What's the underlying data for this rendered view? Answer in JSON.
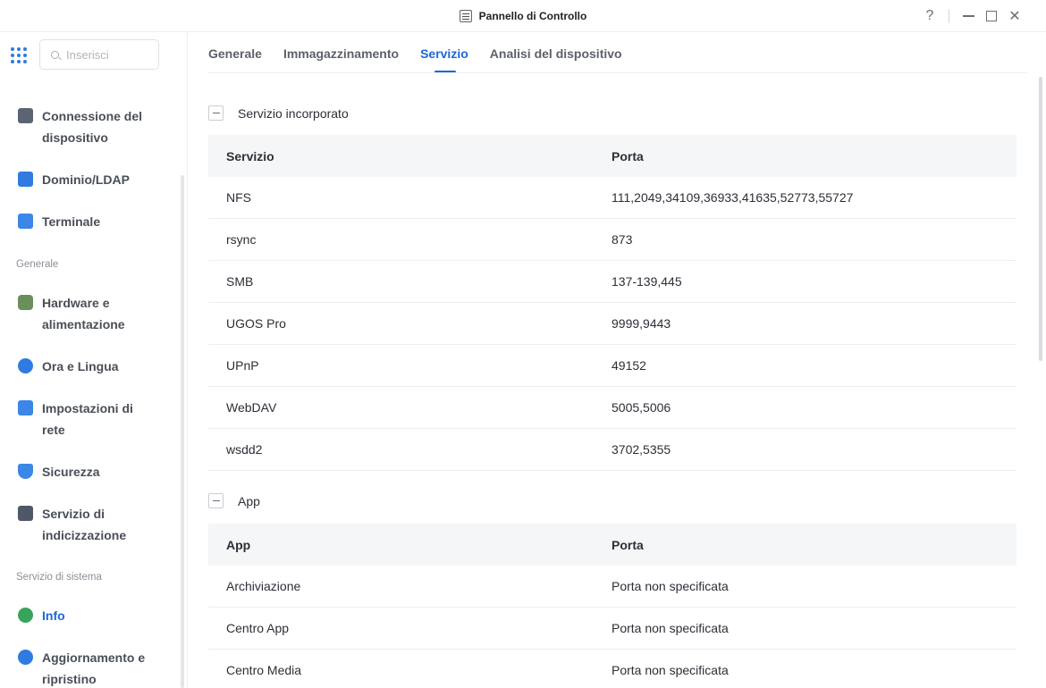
{
  "window": {
    "title": "Pannello di Controllo",
    "help": "?",
    "close": "✕"
  },
  "search": {
    "placeholder": "Inserisci"
  },
  "sidebar": {
    "items": [
      {
        "label": "Connessione del dispositivo",
        "icon": "device-connection-icon"
      },
      {
        "label": "Dominio/LDAP",
        "icon": "domain-ldap-icon"
      },
      {
        "label": "Terminale",
        "icon": "terminal-icon"
      },
      {
        "label": "Hardware e alimentazione",
        "icon": "hardware-power-icon"
      },
      {
        "label": "Ora e Lingua",
        "icon": "globe-icon"
      },
      {
        "label": "Impostazioni di rete",
        "icon": "network-icon"
      },
      {
        "label": "Sicurezza",
        "icon": "shield-icon"
      },
      {
        "label": "Servizio di indicizzazione",
        "icon": "indexing-icon"
      },
      {
        "label": "Info",
        "icon": "info-icon"
      },
      {
        "label": "Aggiornamento e ripristino",
        "icon": "refresh-icon"
      }
    ],
    "sections": [
      "Generale",
      "Servizio di sistema"
    ]
  },
  "tabs": [
    "Generale",
    "Immagazzinamento",
    "Servizio",
    "Analisi del dispositivo"
  ],
  "builtin": {
    "title": "Servizio incorporato",
    "col1": "Servizio",
    "col2": "Porta",
    "rows": [
      {
        "name": "NFS",
        "port": "111,2049,34109,36933,41635,52773,55727"
      },
      {
        "name": "rsync",
        "port": "873"
      },
      {
        "name": "SMB",
        "port": "137-139,445"
      },
      {
        "name": "UGOS Pro",
        "port": "9999,9443"
      },
      {
        "name": "UPnP",
        "port": "49152"
      },
      {
        "name": "WebDAV",
        "port": "5005,5006"
      },
      {
        "name": "wsdd2",
        "port": "3702,5355"
      }
    ]
  },
  "apps": {
    "title": "App",
    "col1": "App",
    "col2": "Porta",
    "rows": [
      {
        "name": "Archiviazione",
        "port": "Porta non specificata"
      },
      {
        "name": "Centro App",
        "port": "Porta non specificata"
      },
      {
        "name": "Centro Media",
        "port": "Porta non specificata"
      }
    ]
  },
  "colors": {
    "accent": "#1e67d6",
    "header_bg": "#f5f6f8",
    "border": "#eceef1"
  }
}
